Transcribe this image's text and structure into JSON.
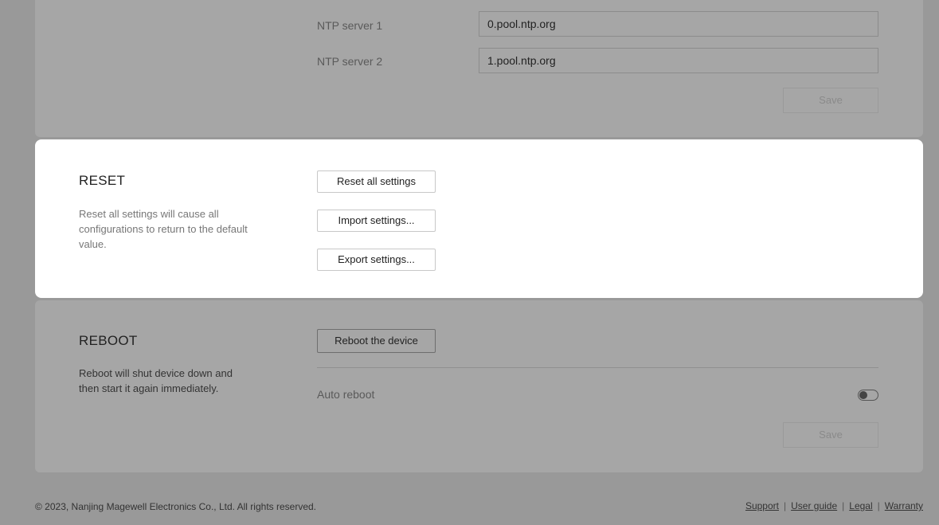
{
  "ntp": {
    "server1_label": "NTP server 1",
    "server1_value": "0.pool.ntp.org",
    "server2_label": "NTP server 2",
    "server2_value": "1.pool.ntp.org",
    "save_label": "Save"
  },
  "reset": {
    "title": "RESET",
    "description": "Reset all settings will cause all configurations to return to the default value.",
    "reset_all_label": "Reset all settings",
    "import_label": "Import settings...",
    "export_label": "Export settings..."
  },
  "reboot": {
    "title": "REBOOT",
    "description": "Reboot will shut device down and then start it again immediately.",
    "reboot_label": "Reboot the device",
    "auto_reboot_label": "Auto reboot",
    "auto_reboot_enabled": false,
    "save_label": "Save"
  },
  "footer": {
    "copyright": "© 2023, Nanjing Magewell Electronics Co., Ltd. All rights reserved.",
    "links": {
      "support": "Support",
      "user_guide": "User guide",
      "legal": "Legal",
      "warranty": "Warranty"
    }
  },
  "colors": {
    "overlay": "#999999",
    "panel_dimmed": "#a6a6a6",
    "modal_panel": "#ffffff"
  }
}
